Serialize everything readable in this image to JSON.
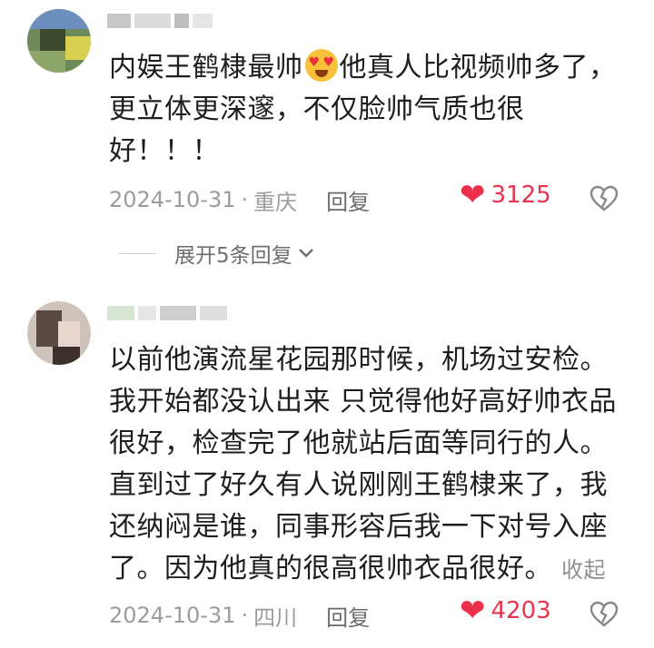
{
  "comments": [
    {
      "text_lines": [
        "内娱王鹤棣最帅",
        "他真人比视频帅多了，",
        "更立体更深邃，不仅脸帅气质也很",
        "好！！！"
      ],
      "emoji": "heart-eyes-emoji",
      "date": "2024-10-31",
      "location": "重庆",
      "reply_label": "回复",
      "likes": "3125",
      "expand_label": "展开5条回复"
    },
    {
      "text_lines": [
        "以前他演流星花园那时候，机场过安检。",
        "我开始都没认出来 只觉得他好高好帅衣品",
        "很好，检查完了他就站后面等同行的人。",
        "直到过了好久有人说刚刚王鹤棣来了，我",
        "还纳闷是谁，同事形容后我一下对号入座",
        "了。因为他真的很高很帅衣品很好。"
      ],
      "collapse_label": "收起",
      "date": "2024-10-31",
      "location": "四川",
      "reply_label": "回复",
      "likes": "4203"
    }
  ],
  "separator": "·",
  "colors": {
    "like": "#ec2f4b",
    "meta": "#9c9c9c",
    "text": "#1e1e1e"
  },
  "icons": [
    "heart-icon",
    "dislike-icon",
    "chevron-down-icon"
  ]
}
